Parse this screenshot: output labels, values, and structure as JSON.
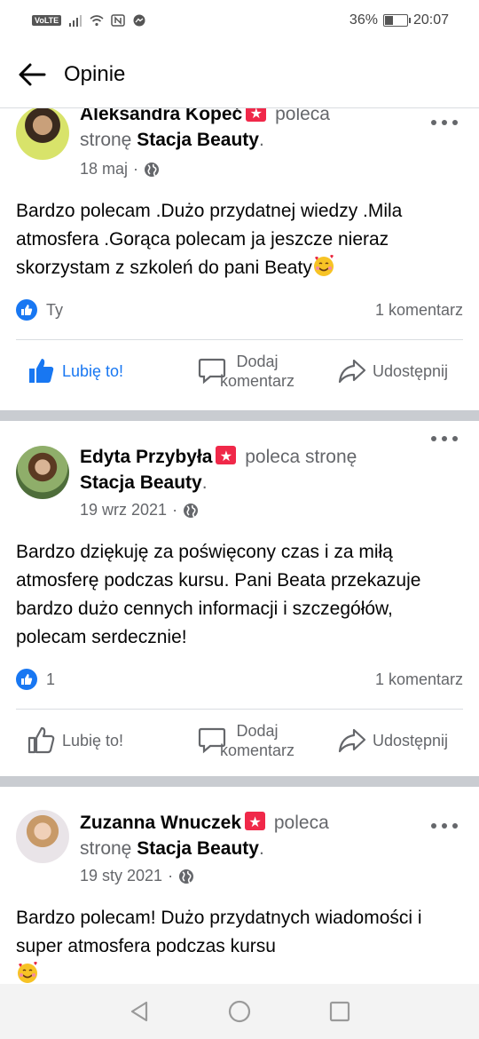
{
  "status_bar": {
    "volte": "VoLTE",
    "battery": "36%",
    "battery_level": 0.36,
    "time": "20:07"
  },
  "header": {
    "title": "Opinie"
  },
  "posts": [
    {
      "author": "Aleksandra Kopeć",
      "verb_before": "poleca",
      "verb_prefix": "stronę",
      "page": "Stacja Beauty",
      "period": ".",
      "date": "18 maj",
      "dot": "·",
      "text": "Bardzo polecam .Dużo przydatnej wiedzy .Mila atmosfera .Gorąca polecam ja jeszcze nieraz skorzystam z szkoleń do pani Beaty",
      "likes": "Ty",
      "comments": "1 komentarz",
      "liked": true
    },
    {
      "author": "Edyta Przybyła",
      "verb_before": "poleca stronę",
      "verb_prefix": "",
      "page": "Stacja Beauty",
      "period": ".",
      "date": "19 wrz 2021",
      "dot": "·",
      "text": "Bardzo dziękuję za poświęcony czas i za miłą atmosferę podczas kursu. Pani Beata przekazuje bardzo dużo cennych informacji i szczegółów, polecam serdecznie!",
      "likes": "1",
      "comments": "1 komentarz",
      "liked": false
    },
    {
      "author": "Zuzanna Wnuczek",
      "verb_before": "poleca",
      "verb_prefix": "stronę",
      "page": "Stacja Beauty",
      "period": ".",
      "date": "19 sty 2021",
      "dot": "·",
      "text": "Bardzo polecam! Dużo przydatnych wiadomości i super atmosfera podczas kursu",
      "liked": false
    }
  ],
  "actions": {
    "like": "Lubię to!",
    "comment_line1": "Dodaj",
    "comment_line2": "komentarz",
    "share": "Udostępnij"
  },
  "colors": {
    "accent": "#1877f2",
    "recommend": "#f02849",
    "divider": "#c9ccd1"
  }
}
